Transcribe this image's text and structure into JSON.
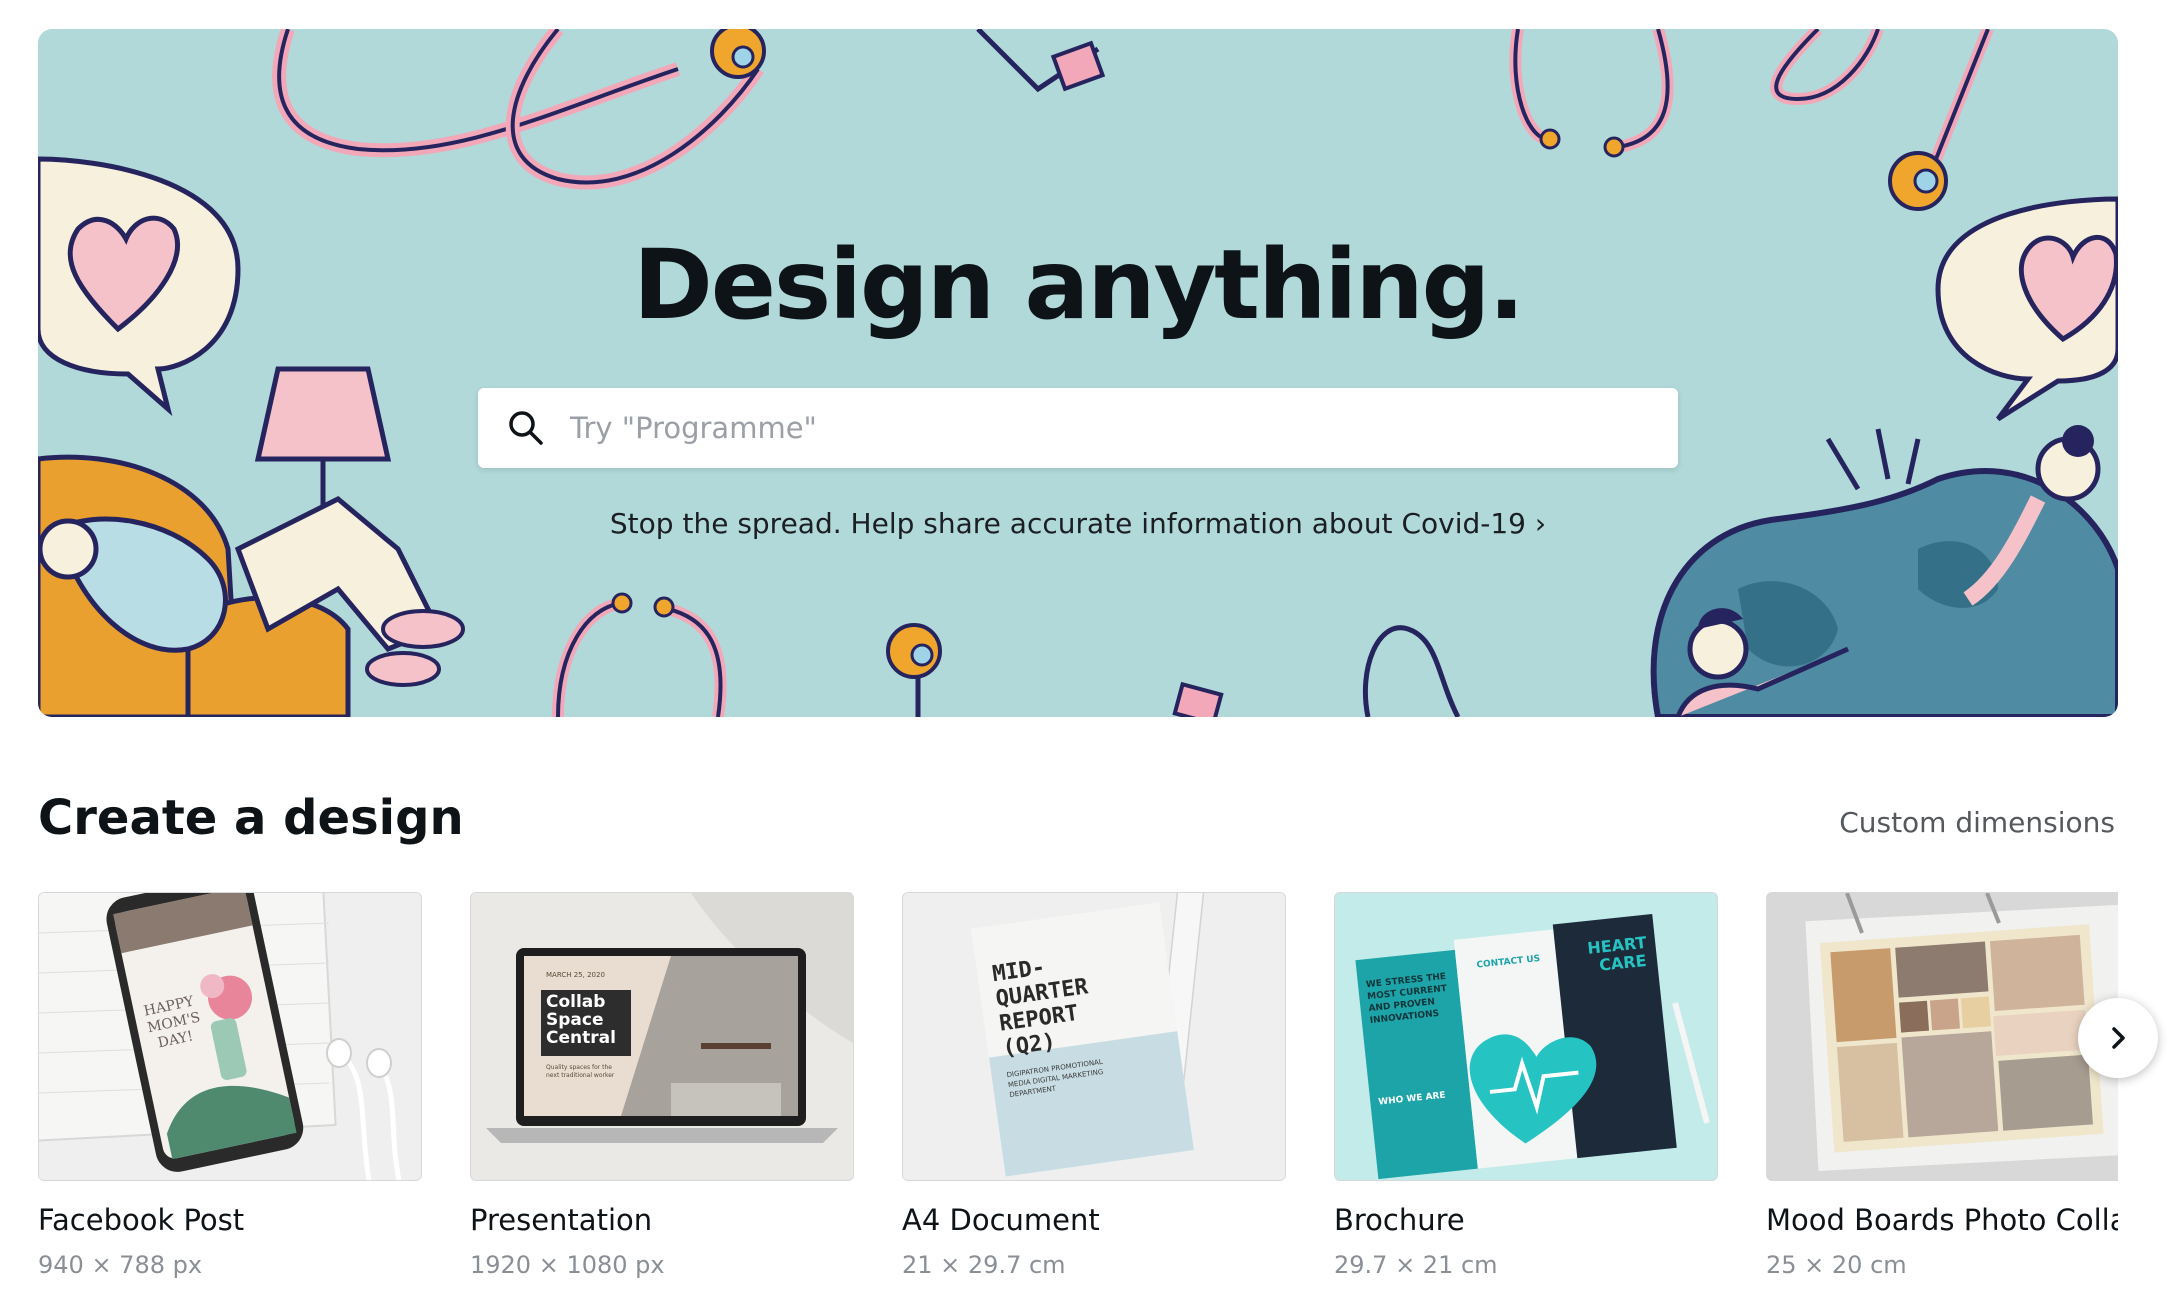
{
  "hero": {
    "title": "Design anything.",
    "search_placeholder": "Try \"Programme\"",
    "covid_link": "Stop the spread. Help share accurate information about Covid-19 ›",
    "background_color": "#b1d9d9"
  },
  "create_section": {
    "title": "Create a design",
    "custom_dimensions": "Custom dimensions",
    "cards": [
      {
        "name": "Facebook Post",
        "size": "940 × 788 px"
      },
      {
        "name": "Presentation",
        "size": "1920 × 1080 px",
        "thumb_text": "MARCH 25, 2020",
        "thumb_title_1": "Collab",
        "thumb_title_2": "Space",
        "thumb_title_3": "Central",
        "thumb_sub_1": "Quality spaces for the",
        "thumb_sub_2": "next traditional worker"
      },
      {
        "name": "A4 Document",
        "size": "21 × 29.7 cm",
        "thumb_title_1": "MID-",
        "thumb_title_2": "QUARTER",
        "thumb_title_3": "REPORT",
        "thumb_title_4": "(Q2)",
        "thumb_sub_1": "DIGIPATRON PROMOTIONAL",
        "thumb_sub_2": "MEDIA DIGITAL MARKETING",
        "thumb_sub_3": "DEPARTMENT"
      },
      {
        "name": "Brochure",
        "size": "29.7 × 21 cm",
        "thumb_title_1": "WE STRESS THE",
        "thumb_title_2": "MOST CURRENT",
        "thumb_title_3": "AND PROVEN",
        "thumb_title_4": "INNOVATIONS",
        "thumb_contact": "CONTACT US",
        "thumb_heart_1": "HEART",
        "thumb_heart_2": "CARE",
        "thumb_who": "WHO WE ARE"
      },
      {
        "name": "Mood Boards Photo Collage",
        "size": "25 × 20 cm"
      }
    ]
  },
  "facebook_thumb": {
    "line1": "HAPPY",
    "line2": "MOM'S",
    "line3": "DAY!"
  },
  "icons": {
    "search": "search-icon",
    "next": "chevron-right-icon"
  }
}
